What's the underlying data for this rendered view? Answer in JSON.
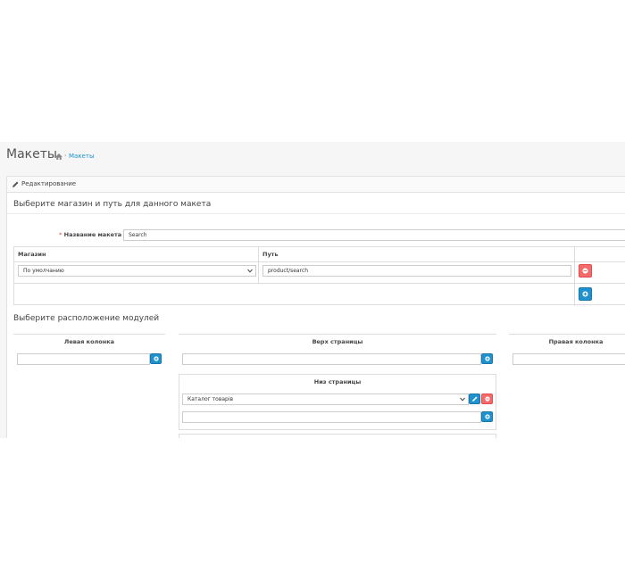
{
  "header": {
    "title": "Макеты",
    "breadcrumb": [
      {
        "label": "Макеты"
      }
    ]
  },
  "panel": {
    "title": "Редактирование",
    "title_icon": "pencil-icon"
  },
  "store_section": {
    "title": "Выберите магазин и путь для данного макета",
    "name_field": {
      "label": "Название макета",
      "required": true,
      "value": "Search"
    },
    "table": {
      "headers": [
        "Магазин",
        "Путь"
      ],
      "rows": [
        {
          "store": "По умолчанию",
          "route": "product/search"
        }
      ],
      "remove_icon": "minus-circle-icon",
      "add_icon": "plus-circle-icon"
    }
  },
  "modules_section": {
    "title": "Выберите расположение модулей",
    "columns": {
      "left": {
        "label": "Левая колонка",
        "select_value": ""
      },
      "top": {
        "label": "Верх страницы",
        "select_value": ""
      },
      "right": {
        "label": "Правая колонка",
        "select_value": ""
      },
      "bottom": {
        "label": "Низ страницы",
        "modules": [
          {
            "value": "Каталог товарів"
          }
        ],
        "select_value": ""
      }
    },
    "edit_icon": "pencil-icon",
    "remove_icon": "minus-circle-icon",
    "add_icon": "plus-circle-icon"
  },
  "colors": {
    "primary": "#1e91cf",
    "danger": "#f56b6b",
    "link": "#1e91cf",
    "required_star": "#f56b6b"
  }
}
